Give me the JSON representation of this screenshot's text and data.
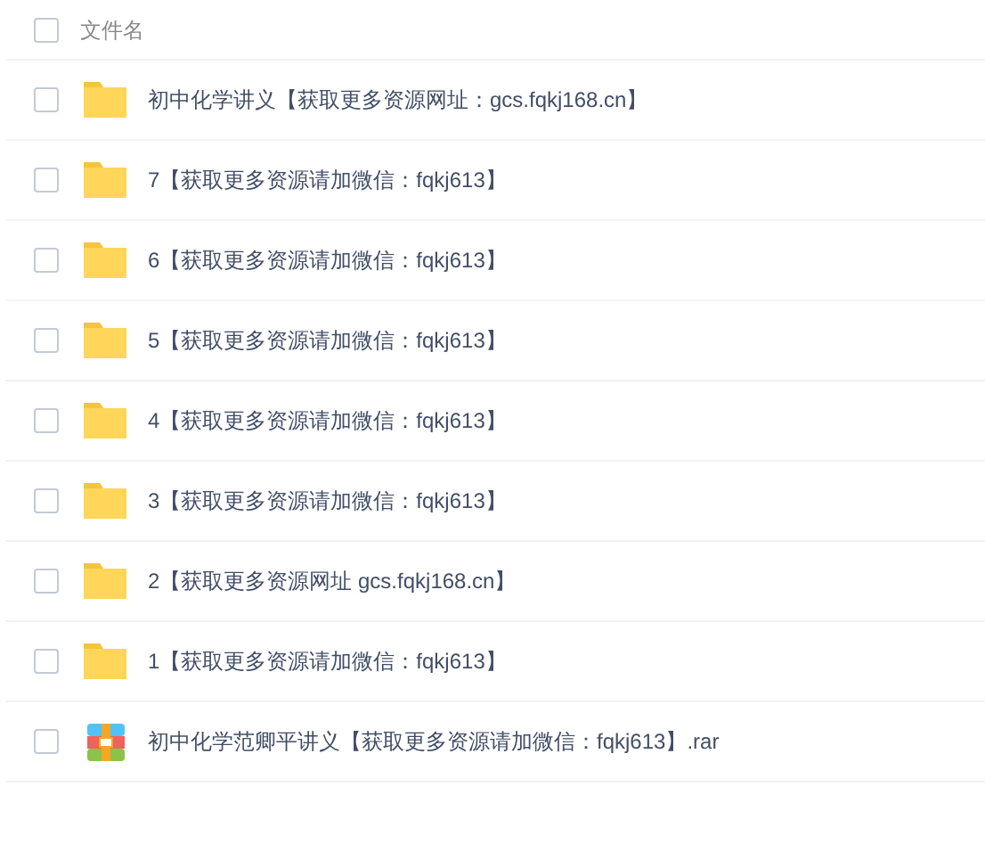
{
  "header": {
    "column_title": "文件名",
    "checked": false
  },
  "files": [
    {
      "kind": "folder",
      "name": "初中化学讲义【获取更多资源网址：gcs.fqkj168.cn】",
      "checked": false
    },
    {
      "kind": "folder",
      "name": "7【获取更多资源请加微信：fqkj613】",
      "checked": false
    },
    {
      "kind": "folder",
      "name": "6【获取更多资源请加微信：fqkj613】",
      "checked": false
    },
    {
      "kind": "folder",
      "name": "5【获取更多资源请加微信：fqkj613】",
      "checked": false
    },
    {
      "kind": "folder",
      "name": "4【获取更多资源请加微信：fqkj613】",
      "checked": false
    },
    {
      "kind": "folder",
      "name": "3【获取更多资源请加微信：fqkj613】",
      "checked": false
    },
    {
      "kind": "folder",
      "name": "2【获取更多资源网址 gcs.fqkj168.cn】",
      "checked": false
    },
    {
      "kind": "folder",
      "name": "1【获取更多资源请加微信：fqkj613】",
      "checked": false
    },
    {
      "kind": "archive",
      "name": "初中化学范卿平讲义【获取更多资源请加微信：fqkj613】.rar",
      "checked": false
    }
  ]
}
